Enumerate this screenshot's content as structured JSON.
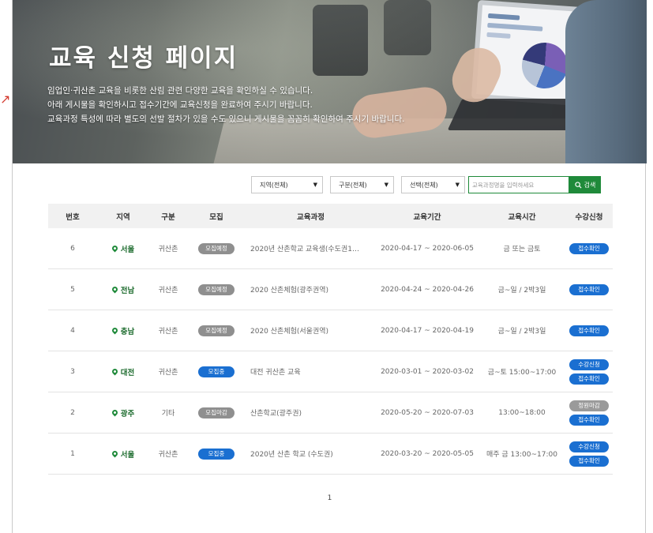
{
  "hero": {
    "title": "교육 신청 페이지",
    "desc_lines": [
      "임업인·귀산촌 교육을 비롯한 산림 관련 다양한 교육을 확인하실 수 있습니다.",
      "아래 게시물을 확인하시고 접수기간에 교육신청을 완료하여 주시기 바랍니다.",
      "교육과정 특성에 따라 별도의 선발 절차가 있을 수도 있으니 게시물을 꼼꼼히 확인하여 주시기 바랍니다."
    ]
  },
  "filters": {
    "region": "지역(전체)",
    "category": "구분(전체)",
    "select": "선택(전체)",
    "search_placeholder": "교육과정명을 입력하세요",
    "search_label": "검색"
  },
  "table": {
    "headers": [
      "번호",
      "지역",
      "구분",
      "모집",
      "교육과정",
      "교육기간",
      "교육시간",
      "수강신청"
    ],
    "rows": [
      {
        "no": "6",
        "region": "서울",
        "category": "귀산촌",
        "status": "모집예정",
        "status_color": "gray",
        "course": "2020년 산촌학교 교육생(수도권1…",
        "period": "2020-04-17 ~ 2020-06-05",
        "time": "금 또는 금토",
        "actions": [
          {
            "label": "접수확인",
            "color": "blue"
          }
        ]
      },
      {
        "no": "5",
        "region": "전남",
        "category": "귀산촌",
        "status": "모집예정",
        "status_color": "gray",
        "course": "2020 산촌체험(광주권역)",
        "period": "2020-04-24 ~ 2020-04-26",
        "time": "금~일 / 2박3일",
        "actions": [
          {
            "label": "접수확인",
            "color": "blue"
          }
        ]
      },
      {
        "no": "4",
        "region": "충남",
        "category": "귀산촌",
        "status": "모집예정",
        "status_color": "gray",
        "course": "2020 산촌체험(서울권역)",
        "period": "2020-04-17 ~ 2020-04-19",
        "time": "금~일 / 2박3일",
        "actions": [
          {
            "label": "접수확인",
            "color": "blue"
          }
        ]
      },
      {
        "no": "3",
        "region": "대전",
        "category": "귀산촌",
        "status": "모집중",
        "status_color": "blue",
        "course": "대전 귀산촌 교육",
        "period": "2020-03-01 ~ 2020-03-02",
        "time": "금~토 15:00~17:00",
        "actions": [
          {
            "label": "수강신청",
            "color": "blue"
          },
          {
            "label": "접수확인",
            "color": "blue"
          }
        ]
      },
      {
        "no": "2",
        "region": "광주",
        "category": "기타",
        "status": "모집마감",
        "status_color": "gray",
        "course": "산촌학교(광주권)",
        "period": "2020-05-20 ~ 2020-07-03",
        "time": "13:00~18:00",
        "actions": [
          {
            "label": "정원마감",
            "color": "gray"
          },
          {
            "label": "접수확인",
            "color": "blue"
          }
        ]
      },
      {
        "no": "1",
        "region": "서울",
        "category": "귀산촌",
        "status": "모집중",
        "status_color": "blue",
        "course": "2020년 산촌 학교 (수도권)",
        "period": "2020-03-20 ~ 2020-05-05",
        "time": "매주 금 13:00~17:00",
        "actions": [
          {
            "label": "수강신청",
            "color": "blue"
          },
          {
            "label": "접수확인",
            "color": "blue"
          }
        ]
      }
    ]
  },
  "pagination": {
    "current": "1"
  },
  "colors": {
    "accent_green": "#1f8a3a",
    "region_green": "#1f6d30",
    "badge_blue": "#1a6fd1",
    "badge_gray": "#8f8f8f"
  }
}
